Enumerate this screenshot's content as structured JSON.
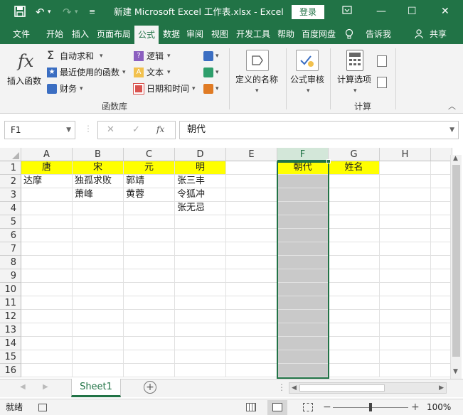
{
  "titlebar": {
    "save_icon": "save-icon",
    "undo_icon": "undo-icon",
    "redo_icon": "redo-icon",
    "customize_icon": "customize-qat-icon",
    "title": "新建 Microsoft Excel 工作表.xlsx  -  Excel",
    "login": "登录"
  },
  "tabs": [
    "文件",
    "开始",
    "插入",
    "页面布局",
    "公式",
    "数据",
    "审阅",
    "视图",
    "开发工具",
    "帮助",
    "百度网盘",
    "告诉我",
    "共享"
  ],
  "ribbon": {
    "insert_function": "插入函数",
    "autosum": "自动求和",
    "recent": "最近使用的函数",
    "finance": "财务",
    "logic": "逻辑",
    "text": "文本",
    "datetime": "日期和时间",
    "define_name": "定义的名称",
    "formula_audit": "公式审核",
    "calc_options": "计算选项",
    "group_library": "函数库",
    "group_calc": "计算"
  },
  "formula_bar": {
    "name_box": "F1",
    "value": "朝代"
  },
  "columns": [
    "A",
    "B",
    "C",
    "D",
    "E",
    "F",
    "G",
    "H"
  ],
  "rows": [
    "1",
    "2",
    "3",
    "4",
    "5",
    "6",
    "7",
    "8",
    "9",
    "10",
    "11",
    "12",
    "13",
    "14",
    "15",
    "16"
  ],
  "cells": {
    "A1": "唐",
    "B1": "宋",
    "C1": "元",
    "D1": "明",
    "F1": "朝代",
    "G1": "姓名",
    "A2": "达摩",
    "B2": "独孤求败",
    "C2": "郭靖",
    "D2": "张三丰",
    "B3": "萧峰",
    "C3": "黄蓉",
    "D3": "令狐冲",
    "D4": "张无忌"
  },
  "sheet_tab": "Sheet1",
  "status": {
    "ready": "就绪",
    "zoom": "100%"
  },
  "colors": {
    "excel_green": "#217346",
    "header_yellow": "#ffff00",
    "selected_gray": "#c9c9c9"
  }
}
